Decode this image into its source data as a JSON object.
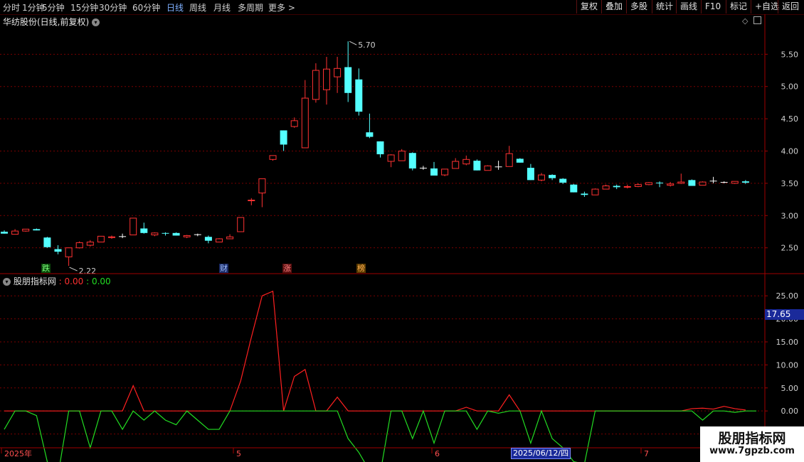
{
  "toolbar": {
    "left": [
      {
        "label": "分时"
      },
      {
        "label": "1分钟"
      },
      {
        "label": "5分钟"
      },
      {
        "label": "15分钟"
      },
      {
        "label": "30分钟"
      },
      {
        "label": "60分钟"
      },
      {
        "label": "日线"
      },
      {
        "label": "周线"
      },
      {
        "label": "月线"
      },
      {
        "label": "多周期"
      },
      {
        "label": "更多"
      }
    ],
    "active": "日线",
    "right": [
      {
        "label": "复权"
      },
      {
        "label": "叠加"
      },
      {
        "label": "多股"
      },
      {
        "label": "统计"
      },
      {
        "label": "画线"
      },
      {
        "label": "F10"
      },
      {
        "label": "标记"
      },
      {
        "label": "+自选"
      },
      {
        "label": "返回"
      }
    ]
  },
  "chart": {
    "title": "华纺股份(日线,前复权)",
    "high_label": "5.70",
    "low_label": "2.22",
    "y_ticks": [
      "5.50",
      "5.00",
      "4.50",
      "4.00",
      "3.50",
      "3.00",
      "2.50"
    ],
    "badges": [
      "跌",
      "财",
      "涨",
      "榜"
    ],
    "colors": {
      "up": "#ff3232",
      "down": "#54ffff",
      "grid": "#7a0000",
      "axis": "#a00000",
      "text": "#c8c8c8"
    }
  },
  "indicator": {
    "name": "股朋指标网",
    "v1": "0.00",
    "v2": "0.00",
    "sep": ":",
    "y_ticks": [
      "25.00",
      "20.00",
      "15.00",
      "10.00",
      "5.00",
      "0.00",
      "-5.00"
    ],
    "price_tag": "17.65",
    "colors": {
      "line1": "#ff2020",
      "line2": "#22dd22"
    }
  },
  "time_axis": {
    "labels": [
      "2025年",
      "5",
      "6",
      "7"
    ],
    "cursor_date": "2025/06/12/四"
  },
  "watermark": {
    "title": "股朋指标网",
    "url": "www.7gpzb.com"
  },
  "chart_data": [
    {
      "type": "candlestick",
      "title": "华纺股份(日线,前复权)",
      "ylim": [
        2.1,
        5.9
      ],
      "candles": [
        {
          "o": 2.75,
          "h": 2.77,
          "l": 2.72,
          "c": 2.72
        },
        {
          "o": 2.71,
          "h": 2.79,
          "l": 2.71,
          "c": 2.76
        },
        {
          "o": 2.76,
          "h": 2.79,
          "l": 2.75,
          "c": 2.79
        },
        {
          "o": 2.79,
          "h": 2.8,
          "l": 2.77,
          "c": 2.77
        },
        {
          "o": 2.66,
          "h": 2.67,
          "l": 2.5,
          "c": 2.51
        },
        {
          "o": 2.48,
          "h": 2.54,
          "l": 2.4,
          "c": 2.44
        },
        {
          "o": 2.36,
          "h": 2.5,
          "l": 2.22,
          "c": 2.5
        },
        {
          "o": 2.5,
          "h": 2.6,
          "l": 2.49,
          "c": 2.58
        },
        {
          "o": 2.54,
          "h": 2.62,
          "l": 2.52,
          "c": 2.59
        },
        {
          "o": 2.59,
          "h": 2.68,
          "l": 2.59,
          "c": 2.68
        },
        {
          "o": 2.66,
          "h": 2.69,
          "l": 2.64,
          "c": 2.67
        },
        {
          "o": 2.68,
          "h": 2.72,
          "l": 2.65,
          "c": 2.68
        },
        {
          "o": 2.7,
          "h": 2.96,
          "l": 2.7,
          "c": 2.96
        },
        {
          "o": 2.8,
          "h": 2.89,
          "l": 2.72,
          "c": 2.73
        },
        {
          "o": 2.7,
          "h": 2.74,
          "l": 2.68,
          "c": 2.73
        },
        {
          "o": 2.73,
          "h": 2.74,
          "l": 2.69,
          "c": 2.72
        },
        {
          "o": 2.73,
          "h": 2.74,
          "l": 2.69,
          "c": 2.69
        },
        {
          "o": 2.67,
          "h": 2.7,
          "l": 2.65,
          "c": 2.69
        },
        {
          "o": 2.71,
          "h": 2.72,
          "l": 2.68,
          "c": 2.71
        },
        {
          "o": 2.67,
          "h": 2.69,
          "l": 2.57,
          "c": 2.61
        },
        {
          "o": 2.59,
          "h": 2.65,
          "l": 2.59,
          "c": 2.64
        },
        {
          "o": 2.64,
          "h": 2.71,
          "l": 2.64,
          "c": 2.67
        },
        {
          "o": 2.75,
          "h": 2.97,
          "l": 2.75,
          "c": 2.97
        },
        {
          "o": 3.23,
          "h": 3.27,
          "l": 3.16,
          "c": 3.24
        },
        {
          "o": 3.35,
          "h": 3.57,
          "l": 3.13,
          "c": 3.57
        },
        {
          "o": 3.87,
          "h": 3.93,
          "l": 3.85,
          "c": 3.93
        },
        {
          "o": 4.32,
          "h": 4.32,
          "l": 4.0,
          "c": 4.1
        },
        {
          "o": 4.38,
          "h": 4.52,
          "l": 4.36,
          "c": 4.47
        },
        {
          "o": 4.05,
          "h": 5.1,
          "l": 4.05,
          "c": 4.82
        },
        {
          "o": 4.8,
          "h": 5.36,
          "l": 4.75,
          "c": 5.25
        },
        {
          "o": 4.95,
          "h": 5.46,
          "l": 4.72,
          "c": 5.27
        },
        {
          "o": 5.15,
          "h": 5.46,
          "l": 4.9,
          "c": 5.28
        },
        {
          "o": 5.3,
          "h": 5.7,
          "l": 4.76,
          "c": 4.9
        },
        {
          "o": 5.11,
          "h": 5.28,
          "l": 4.55,
          "c": 4.61
        },
        {
          "o": 4.29,
          "h": 4.58,
          "l": 4.2,
          "c": 4.22
        },
        {
          "o": 4.15,
          "h": 4.15,
          "l": 3.9,
          "c": 3.95
        },
        {
          "o": 3.84,
          "h": 3.95,
          "l": 3.75,
          "c": 3.94
        },
        {
          "o": 3.85,
          "h": 4.03,
          "l": 3.85,
          "c": 4.0
        },
        {
          "o": 3.97,
          "h": 3.98,
          "l": 3.7,
          "c": 3.73
        },
        {
          "o": 3.74,
          "h": 3.77,
          "l": 3.71,
          "c": 3.74
        },
        {
          "o": 3.73,
          "h": 3.83,
          "l": 3.62,
          "c": 3.62
        },
        {
          "o": 3.63,
          "h": 3.72,
          "l": 3.61,
          "c": 3.72
        },
        {
          "o": 3.73,
          "h": 3.89,
          "l": 3.73,
          "c": 3.84
        },
        {
          "o": 3.8,
          "h": 3.93,
          "l": 3.78,
          "c": 3.87
        },
        {
          "o": 3.85,
          "h": 3.87,
          "l": 3.7,
          "c": 3.7
        },
        {
          "o": 3.7,
          "h": 3.78,
          "l": 3.7,
          "c": 3.77
        },
        {
          "o": 3.76,
          "h": 3.85,
          "l": 3.71,
          "c": 3.76
        },
        {
          "o": 3.76,
          "h": 4.08,
          "l": 3.76,
          "c": 3.96
        },
        {
          "o": 3.88,
          "h": 3.89,
          "l": 3.82,
          "c": 3.82
        },
        {
          "o": 3.74,
          "h": 3.8,
          "l": 3.55,
          "c": 3.55
        },
        {
          "o": 3.55,
          "h": 3.66,
          "l": 3.53,
          "c": 3.63
        },
        {
          "o": 3.63,
          "h": 3.64,
          "l": 3.55,
          "c": 3.58
        },
        {
          "o": 3.57,
          "h": 3.58,
          "l": 3.49,
          "c": 3.51
        },
        {
          "o": 3.48,
          "h": 3.49,
          "l": 3.36,
          "c": 3.36
        },
        {
          "o": 3.34,
          "h": 3.37,
          "l": 3.29,
          "c": 3.32
        },
        {
          "o": 3.32,
          "h": 3.42,
          "l": 3.32,
          "c": 3.41
        },
        {
          "o": 3.41,
          "h": 3.48,
          "l": 3.41,
          "c": 3.46
        },
        {
          "o": 3.46,
          "h": 3.48,
          "l": 3.41,
          "c": 3.44
        },
        {
          "o": 3.44,
          "h": 3.48,
          "l": 3.42,
          "c": 3.45
        },
        {
          "o": 3.45,
          "h": 3.5,
          "l": 3.44,
          "c": 3.48
        },
        {
          "o": 3.48,
          "h": 3.52,
          "l": 3.47,
          "c": 3.51
        },
        {
          "o": 3.51,
          "h": 3.53,
          "l": 3.44,
          "c": 3.5
        },
        {
          "o": 3.47,
          "h": 3.52,
          "l": 3.45,
          "c": 3.49
        },
        {
          "o": 3.5,
          "h": 3.65,
          "l": 3.49,
          "c": 3.52
        },
        {
          "o": 3.55,
          "h": 3.56,
          "l": 3.46,
          "c": 3.46
        },
        {
          "o": 3.47,
          "h": 3.53,
          "l": 3.47,
          "c": 3.52
        },
        {
          "o": 3.54,
          "h": 3.6,
          "l": 3.5,
          "c": 3.54
        },
        {
          "o": 3.52,
          "h": 3.53,
          "l": 3.5,
          "c": 3.52
        },
        {
          "o": 3.5,
          "h": 3.53,
          "l": 3.49,
          "c": 3.53
        },
        {
          "o": 3.53,
          "h": 3.55,
          "l": 3.49,
          "c": 3.51
        }
      ]
    },
    {
      "type": "line",
      "title": "股朋指标网",
      "ylim": [
        -8,
        27.5
      ],
      "series": [
        {
          "values": [
            0,
            0,
            0,
            0,
            0,
            0,
            0,
            0,
            0,
            0,
            0,
            0,
            5.5,
            0,
            0,
            0,
            0,
            0,
            0,
            0,
            0,
            0,
            6.5,
            16,
            25,
            26,
            0,
            7.5,
            9,
            0,
            0,
            3,
            0,
            0,
            0,
            0,
            0,
            0,
            0,
            0,
            0,
            0,
            0,
            0.8,
            0,
            0,
            0,
            3.5,
            0,
            0,
            0,
            0,
            0,
            0,
            0,
            0,
            0,
            0,
            0,
            0,
            0,
            0,
            0,
            0,
            0.5,
            0.6,
            0.4,
            1,
            0.5,
            0.2
          ]
        },
        {
          "values": [
            -4,
            0,
            0,
            -1,
            -11,
            -14,
            0,
            0,
            -8,
            0,
            0,
            -4,
            0,
            -2,
            0,
            -2,
            -3,
            0,
            -2,
            -4,
            -4,
            0,
            0,
            0,
            0,
            0,
            0,
            0,
            0,
            0,
            0,
            0,
            -6,
            -9,
            -13,
            -13.5,
            0,
            0,
            -6,
            0,
            -7,
            0,
            0,
            0,
            -4,
            0,
            -0.5,
            0,
            0,
            -7,
            0,
            -6,
            -8,
            -11,
            -11.5,
            0,
            0,
            0,
            0,
            0,
            0,
            0,
            0,
            0,
            0,
            -2,
            0,
            0,
            -0.3,
            0,
            0
          ]
        }
      ]
    }
  ]
}
